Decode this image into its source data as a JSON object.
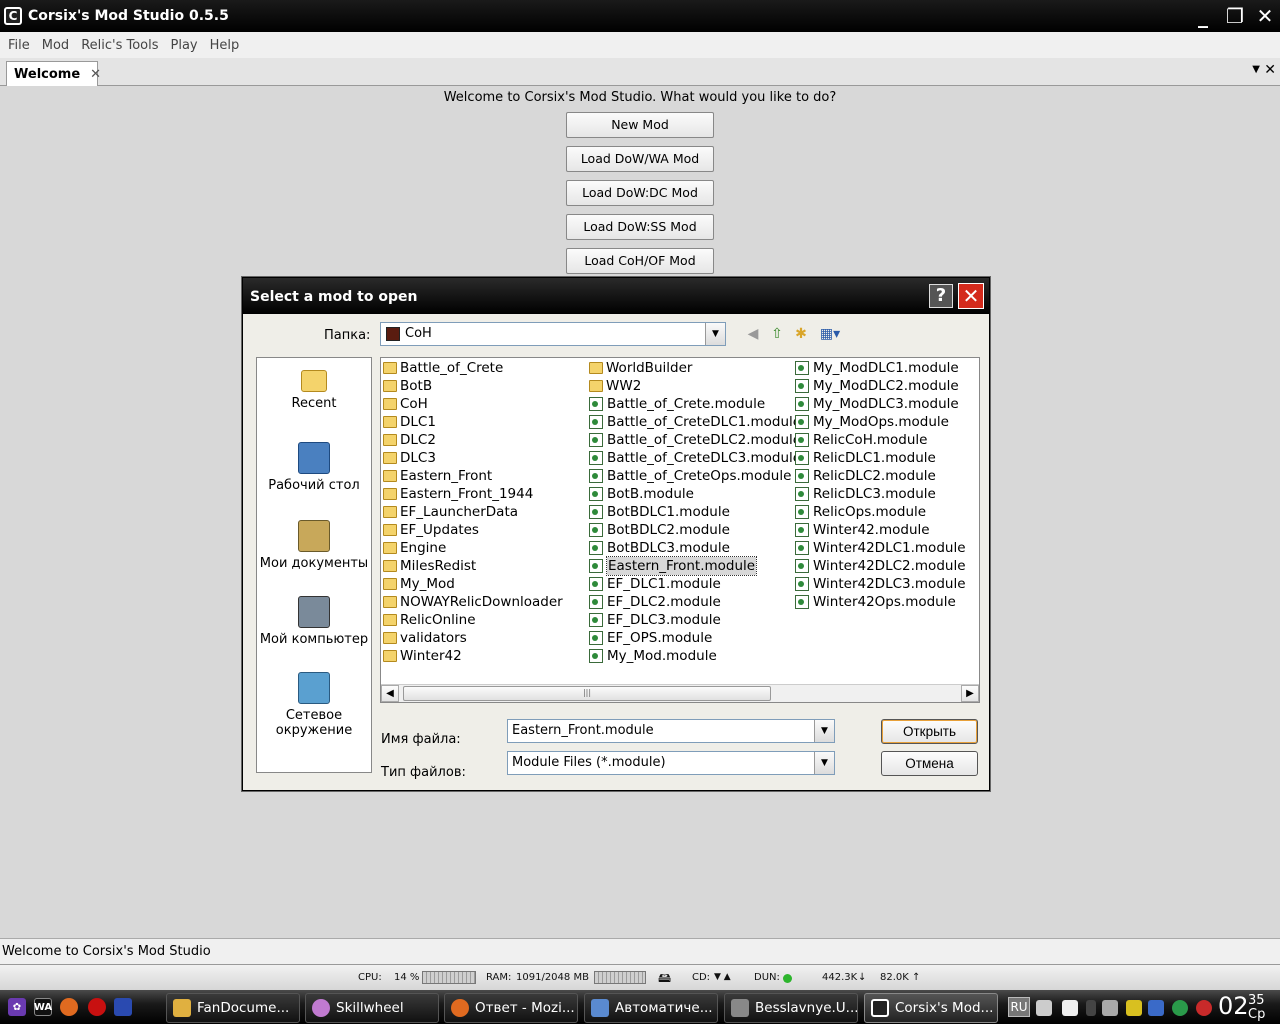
{
  "window": {
    "title": "Corsix's Mod Studio 0.5.5"
  },
  "menu": [
    "File",
    "Mod",
    "Relic's Tools",
    "Play",
    "Help"
  ],
  "tab": {
    "label": "Welcome"
  },
  "welcome": {
    "message": "Welcome to Corsix's Mod Studio. What would you like to do?",
    "buttons": [
      "New Mod",
      "Load DoW/WA Mod",
      "Load DoW:DC Mod",
      "Load DoW:SS Mod",
      "Load CoH/OF Mod"
    ]
  },
  "status": {
    "text": "Welcome to Corsix's Mod Studio"
  },
  "sysmon": {
    "cpu_label": "CPU:",
    "cpu_value": "14 %",
    "ram_label": "RAM:",
    "ram_value": "1091/2048 MB",
    "cd_label": "CD:",
    "dun_label": "DUN:",
    "down_rate": "442.3K",
    "up_rate": "82.0K"
  },
  "dialog": {
    "title": "Select a mod to open",
    "folder_label": "Папка:",
    "folder_value": "CoH",
    "places": [
      {
        "label": "Recent",
        "icon": "recent-folder-icon"
      },
      {
        "label": "Рабочий стол",
        "icon": "desktop-icon"
      },
      {
        "label": "Мои документы",
        "icon": "my-documents-icon"
      },
      {
        "label": "Мой компьютер",
        "icon": "my-computer-icon"
      },
      {
        "label": "Сетевое окружение",
        "icon": "network-icon"
      }
    ],
    "columns": [
      [
        {
          "name": "Battle_of_Crete",
          "kind": "folder"
        },
        {
          "name": "BotB",
          "kind": "folder"
        },
        {
          "name": "CoH",
          "kind": "folder"
        },
        {
          "name": "DLC1",
          "kind": "folder"
        },
        {
          "name": "DLC2",
          "kind": "folder"
        },
        {
          "name": "DLC3",
          "kind": "folder"
        },
        {
          "name": "Eastern_Front",
          "kind": "folder"
        },
        {
          "name": "Eastern_Front_1944",
          "kind": "folder"
        },
        {
          "name": "EF_LauncherData",
          "kind": "folder"
        },
        {
          "name": "EF_Updates",
          "kind": "folder"
        },
        {
          "name": "Engine",
          "kind": "folder"
        },
        {
          "name": "MilesRedist",
          "kind": "folder"
        },
        {
          "name": "My_Mod",
          "kind": "folder"
        },
        {
          "name": "NOWAYRelicDownloader",
          "kind": "folder"
        },
        {
          "name": "RelicOnline",
          "kind": "folder"
        },
        {
          "name": "validators",
          "kind": "folder"
        },
        {
          "name": "Winter42",
          "kind": "folder"
        }
      ],
      [
        {
          "name": "WorldBuilder",
          "kind": "folder"
        },
        {
          "name": "WW2",
          "kind": "folder"
        },
        {
          "name": "Battle_of_Crete.module",
          "kind": "doc"
        },
        {
          "name": "Battle_of_CreteDLC1.module",
          "kind": "doc"
        },
        {
          "name": "Battle_of_CreteDLC2.module",
          "kind": "doc"
        },
        {
          "name": "Battle_of_CreteDLC3.module",
          "kind": "doc"
        },
        {
          "name": "Battle_of_CreteOps.module",
          "kind": "doc"
        },
        {
          "name": "BotB.module",
          "kind": "doc"
        },
        {
          "name": "BotBDLC1.module",
          "kind": "doc"
        },
        {
          "name": "BotBDLC2.module",
          "kind": "doc"
        },
        {
          "name": "BotBDLC3.module",
          "kind": "doc"
        },
        {
          "name": "Eastern_Front.module",
          "kind": "doc",
          "selected": true
        },
        {
          "name": "EF_DLC1.module",
          "kind": "doc"
        },
        {
          "name": "EF_DLC2.module",
          "kind": "doc"
        },
        {
          "name": "EF_DLC3.module",
          "kind": "doc"
        },
        {
          "name": "EF_OPS.module",
          "kind": "doc"
        },
        {
          "name": "My_Mod.module",
          "kind": "doc"
        }
      ],
      [
        {
          "name": "My_ModDLC1.module",
          "kind": "doc"
        },
        {
          "name": "My_ModDLC2.module",
          "kind": "doc"
        },
        {
          "name": "My_ModDLC3.module",
          "kind": "doc"
        },
        {
          "name": "My_ModOps.module",
          "kind": "doc"
        },
        {
          "name": "RelicCoH.module",
          "kind": "doc"
        },
        {
          "name": "RelicDLC1.module",
          "kind": "doc"
        },
        {
          "name": "RelicDLC2.module",
          "kind": "doc"
        },
        {
          "name": "RelicDLC3.module",
          "kind": "doc"
        },
        {
          "name": "RelicOps.module",
          "kind": "doc"
        },
        {
          "name": "Winter42.module",
          "kind": "doc"
        },
        {
          "name": "Winter42DLC1.module",
          "kind": "doc"
        },
        {
          "name": "Winter42DLC2.module",
          "kind": "doc"
        },
        {
          "name": "Winter42DLC3.module",
          "kind": "doc"
        },
        {
          "name": "Winter42Ops.module",
          "kind": "doc"
        }
      ]
    ],
    "filename_label": "Имя файла:",
    "filename_value": "Eastern_Front.module",
    "filetype_label": "Тип файлов:",
    "filetype_value": "Module Files (*.module)",
    "open_button": "Открыть",
    "cancel_button": "Отмена"
  },
  "taskbar": {
    "tasks": [
      {
        "label": "FanDocume...",
        "color": "#e0b040"
      },
      {
        "label": "Skillwheel",
        "color": "#c07ad0"
      },
      {
        "label": "Ответ - Mozi...",
        "color": "#e06a20"
      },
      {
        "label": "Автоматиче...",
        "color": "#5a8ad0"
      },
      {
        "label": "Besslavnye.U...",
        "color": "#888888"
      },
      {
        "label": "Corsix's Mod...",
        "color": "#ffffff"
      }
    ],
    "language": "RU",
    "clock_hour": "02",
    "clock_minute": "35",
    "clock_day": "Ср"
  },
  "colors": {
    "titlebar": "#000000",
    "dialog_close": "#d42a1c",
    "folder": "#f4d36b"
  }
}
